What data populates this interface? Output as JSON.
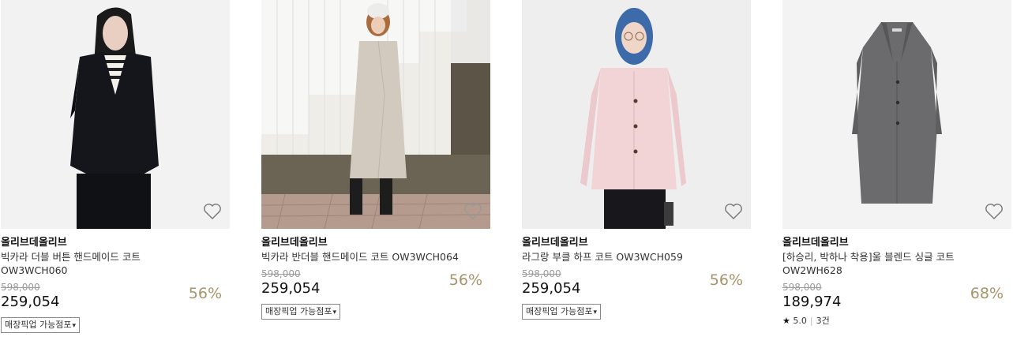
{
  "products": [
    {
      "brand": "올리브데올리브",
      "name": "빅카라 더블 버튼 핸드메이드 코트 OW3WCH060",
      "original_price": "598,000",
      "price": "259,054",
      "discount": "56%",
      "pickup_label": "매장픽업 가능점포",
      "pickup_caret": "▾",
      "image_icon": "model-black-coat-photo",
      "heart_icon": "heart-outline-icon"
    },
    {
      "brand": "올리브데올리브",
      "name": "빅카라 반더블 핸드메이드 코트 OW3WCH064",
      "original_price": "598,000",
      "price": "259,054",
      "discount": "56%",
      "pickup_label": "매장픽업 가능점포",
      "pickup_caret": "▾",
      "image_icon": "model-beige-coat-photo",
      "heart_icon": "heart-outline-icon"
    },
    {
      "brand": "올리브데올리브",
      "name": "라그랑 부클 하프 코트 OW3WCH059",
      "original_price": "598,000",
      "price": "259,054",
      "discount": "56%",
      "pickup_label": "매장픽업 가능점포",
      "pickup_caret": "▾",
      "image_icon": "model-pink-coat-photo",
      "heart_icon": "heart-outline-icon"
    },
    {
      "brand": "올리브데올리브",
      "name": "[하승리, 박하나 착용]울 블렌드 싱글 코트 OW2WH628",
      "original_price": "598,000",
      "price": "189,974",
      "discount": "68%",
      "rating_star": "★",
      "rating_value": "5.0",
      "review_count": "3건",
      "image_icon": "grey-long-coat-photo",
      "heart_icon": "heart-outline-icon"
    }
  ],
  "colors": {
    "discount": "#a8946a",
    "original_price": "#9a9a9a",
    "text": "#222222"
  }
}
